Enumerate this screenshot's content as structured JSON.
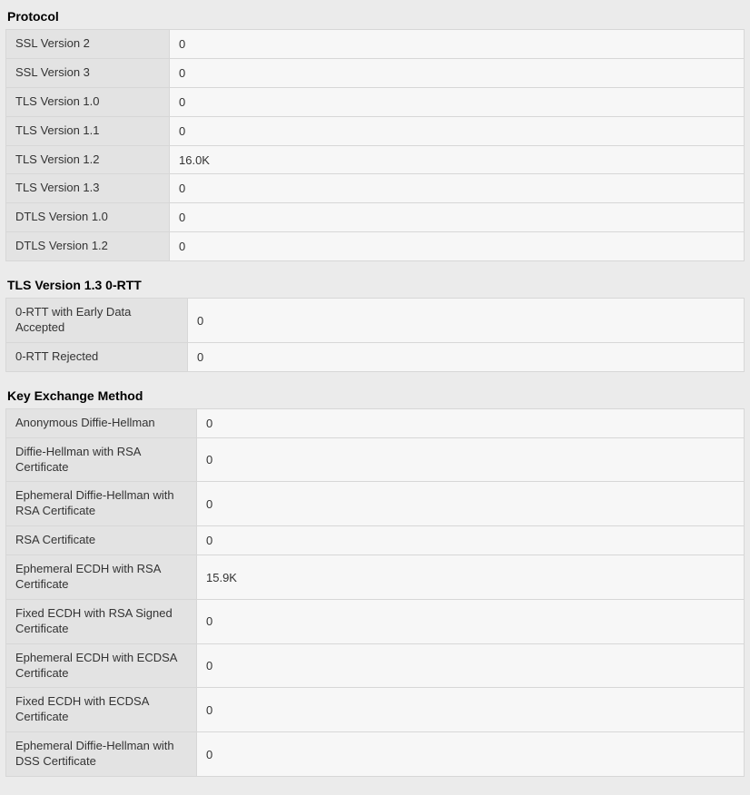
{
  "sections": {
    "protocol": {
      "title": "Protocol",
      "rows": [
        {
          "label": "SSL Version 2",
          "value": "0"
        },
        {
          "label": "SSL Version 3",
          "value": "0"
        },
        {
          "label": "TLS Version 1.0",
          "value": "0"
        },
        {
          "label": "TLS Version 1.1",
          "value": "0"
        },
        {
          "label": "TLS Version 1.2",
          "value": "16.0K"
        },
        {
          "label": "TLS Version 1.3",
          "value": "0"
        },
        {
          "label": "DTLS Version 1.0",
          "value": "0"
        },
        {
          "label": "DTLS Version 1.2",
          "value": "0"
        }
      ]
    },
    "rtt": {
      "title": "TLS Version 1.3 0-RTT",
      "rows": [
        {
          "label": "0-RTT with Early Data Accepted",
          "value": "0"
        },
        {
          "label": "0-RTT Rejected",
          "value": "0"
        }
      ]
    },
    "kex": {
      "title": "Key Exchange Method",
      "rows": [
        {
          "label": "Anonymous Diffie-Hellman",
          "value": "0"
        },
        {
          "label": "Diffie-Hellman with RSA Certificate",
          "value": "0"
        },
        {
          "label": "Ephemeral Diffie-Hellman with RSA Certificate",
          "value": "0"
        },
        {
          "label": "RSA Certificate",
          "value": "0"
        },
        {
          "label": "Ephemeral ECDH with RSA Certificate",
          "value": "15.9K"
        },
        {
          "label": "Fixed ECDH with RSA Signed Certificate",
          "value": "0"
        },
        {
          "label": "Ephemeral ECDH with ECDSA Certificate",
          "value": "0"
        },
        {
          "label": "Fixed ECDH with ECDSA Certificate",
          "value": "0"
        },
        {
          "label": "Ephemeral Diffie-Hellman with DSS Certificate",
          "value": "0"
        }
      ]
    }
  }
}
